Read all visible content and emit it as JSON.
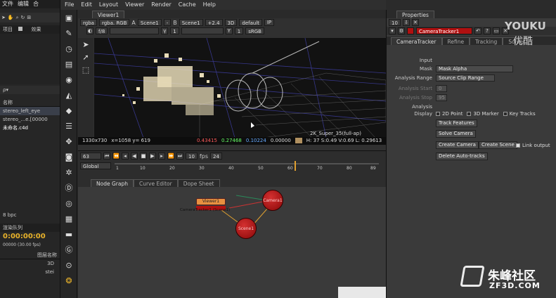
{
  "ae": {
    "menu": [
      "文件",
      "编辑",
      "合"
    ],
    "panel_label": "项目",
    "panel_tab": "效果",
    "search": "ρ▾",
    "col_name": "名称",
    "files": [
      "stereo_left_eye",
      "stereo_...e.[00000",
      "未命名.c4d"
    ],
    "bpc": "8 bpc",
    "render_label": "渲染队列",
    "timecode": "0:00:00:00",
    "timecode_sub": "00000 (30.00 fps)",
    "layer_col": "图层名称",
    "layers": [
      "3D",
      "stei"
    ]
  },
  "nuke": {
    "menu": [
      "File",
      "Edit",
      "Layout",
      "Viewer",
      "Render",
      "Cache",
      "Help"
    ],
    "viewer_tab": "Viewer1",
    "viewer_controls": {
      "channels": "rgba",
      "layer": "rgba. RGB",
      "a_label": "A",
      "a_input": "Scene1",
      "ops": "-",
      "b_label": "B",
      "b_input": "Scene1",
      "zoom": "+2.4",
      "mode": "3D",
      "lut": "default",
      "ip": "IP"
    },
    "viewer_controls2": {
      "fstop": "f/8",
      "frame": "1",
      "y": "Y",
      "rate": "1",
      "colorspace": "sRGB"
    },
    "info": {
      "res": "1330x730",
      "xy": "x=1058 y= 619",
      "r": "0.43415",
      "g": "0.27468",
      "b": "0.10224",
      "a": "0.00000",
      "hsv": "H: 37 S:0.49 V:0.69 L: 0.29613",
      "format": "2K_Super_35(full-ap)"
    },
    "timeline": {
      "frame": "63",
      "step": "10",
      "fps_label": "fps",
      "fps": "24",
      "scope": "Global",
      "ticks": [
        "1",
        "10",
        "20",
        "30",
        "40",
        "50",
        "60",
        "70",
        "80",
        "89"
      ]
    },
    "node_tabs": [
      "Node Graph",
      "Curve Editor",
      "Dope Sheet"
    ],
    "nodes": {
      "viewer": "Viewer1",
      "tracker": "CameraTracker1 (Scene1)",
      "camera": "Camera1",
      "scene": "Scene1"
    }
  },
  "props": {
    "title": "Properties",
    "count": "10",
    "node_name": "CameraTracker1",
    "tabs": [
      "CameraTracker",
      "Refine",
      "Tracking",
      "Solver"
    ],
    "input_label": "Input",
    "mask_label": "Mask",
    "mask_value": "Mask Alpha",
    "range_label": "Analysis Range",
    "range_value": "Source Clip Range",
    "start_label": "Analysis Start",
    "start_value": "0",
    "stop_label": "Analysis Stop",
    "stop_value": "95",
    "analysis_label": "Analysis",
    "display_label": "Display",
    "display_opts": [
      "2D Point",
      "3D Marker",
      "Key Tracks"
    ],
    "buttons": {
      "track": "Track Features",
      "solve": "Solve Camera",
      "create_camera": "Create Camera",
      "create_scene": "Create Scene",
      "link_output": "Link output",
      "delete": "Delete Auto-tracks"
    }
  },
  "watermark": {
    "youku": "YOUKU",
    "youku_cn": "优酷",
    "zf": "朱峰社区",
    "zf_url": "ZF3D.COM"
  }
}
